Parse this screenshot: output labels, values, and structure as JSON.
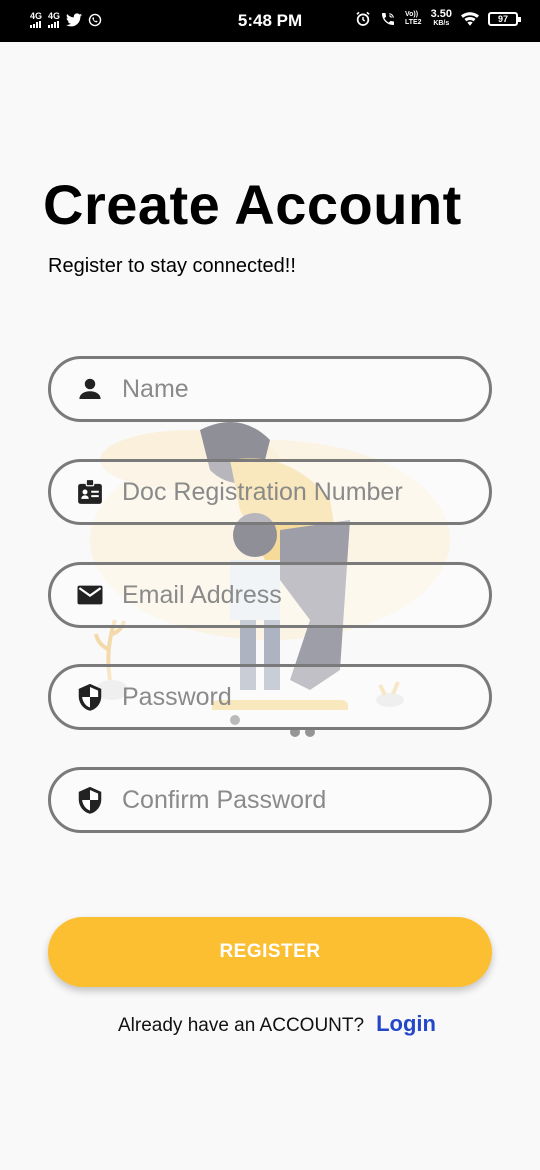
{
  "status_bar": {
    "network_1": "4G",
    "network_2": "4G",
    "time": "5:48 PM",
    "volte": "Vo))",
    "lte": "LTE2",
    "speed_value": "3.50",
    "speed_unit": "KB/s",
    "battery": "97"
  },
  "header": {
    "title": "Create Account",
    "subtitle": "Register to stay connected!!"
  },
  "form": {
    "name_placeholder": "Name",
    "doc_placeholder": "Doc Registration Number",
    "email_placeholder": "Email Address",
    "password_placeholder": "Password",
    "confirm_placeholder": "Confirm Password"
  },
  "actions": {
    "register_label": "REGISTER",
    "login_prompt": "Already have an ACCOUNT?",
    "login_link": "Login"
  },
  "colors": {
    "accent": "#fdbf32",
    "link": "#2347c8",
    "field_border": "#7a7a7a"
  }
}
